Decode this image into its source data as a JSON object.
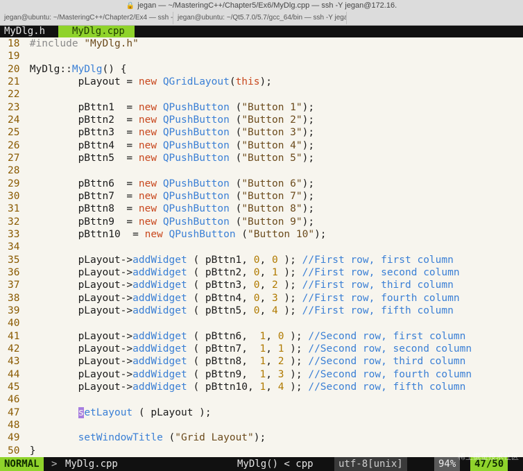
{
  "window": {
    "title": "jegan — ~/MasteringC++/Chapter5/Ex6/MyDlg.cpp — ssh -Y jegan@172.16.",
    "tabs": [
      "jegan@ubuntu: ~/MasteringC++/Chapter2/Ex4 — ssh -Y...",
      "jegan@ubuntu: ~/Qt5.7.0/5.7/gcc_64/bin — ssh -Y jegan...",
      ""
    ]
  },
  "tabline": {
    "buffers": [
      "MyDlg.h",
      "MyDlg.cpp"
    ],
    "active_index": 1
  },
  "code": {
    "lines": [
      {
        "n": "18",
        "tokens": [
          [
            "#include ",
            "pre"
          ],
          [
            "\"MyDlg.h\"",
            "str"
          ]
        ]
      },
      {
        "n": "19",
        "tokens": []
      },
      {
        "n": "20",
        "tokens": [
          [
            "MyDlg::",
            "plain"
          ],
          [
            "MyDlg",
            "type"
          ],
          [
            "() {",
            "plain"
          ]
        ]
      },
      {
        "n": "21",
        "tokens": [
          [
            "        pLayout = ",
            "plain"
          ],
          [
            "new",
            "kw"
          ],
          [
            " ",
            "plain"
          ],
          [
            "QGridLayout",
            "type"
          ],
          [
            "(",
            "plain"
          ],
          [
            "this",
            "kw"
          ],
          [
            ");",
            "plain"
          ]
        ]
      },
      {
        "n": "22",
        "tokens": []
      },
      {
        "n": "23",
        "tokens": [
          [
            "        pBttn1  = ",
            "plain"
          ],
          [
            "new",
            "kw"
          ],
          [
            " ",
            "plain"
          ],
          [
            "QPushButton",
            "type"
          ],
          [
            " (",
            "plain"
          ],
          [
            "\"Button 1\"",
            "str"
          ],
          [
            ");",
            "plain"
          ]
        ]
      },
      {
        "n": "24",
        "tokens": [
          [
            "        pBttn2  = ",
            "plain"
          ],
          [
            "new",
            "kw"
          ],
          [
            " ",
            "plain"
          ],
          [
            "QPushButton",
            "type"
          ],
          [
            " (",
            "plain"
          ],
          [
            "\"Button 2\"",
            "str"
          ],
          [
            ");",
            "plain"
          ]
        ]
      },
      {
        "n": "25",
        "tokens": [
          [
            "        pBttn3  = ",
            "plain"
          ],
          [
            "new",
            "kw"
          ],
          [
            " ",
            "plain"
          ],
          [
            "QPushButton",
            "type"
          ],
          [
            " (",
            "plain"
          ],
          [
            "\"Button 3\"",
            "str"
          ],
          [
            ");",
            "plain"
          ]
        ]
      },
      {
        "n": "26",
        "tokens": [
          [
            "        pBttn4  = ",
            "plain"
          ],
          [
            "new",
            "kw"
          ],
          [
            " ",
            "plain"
          ],
          [
            "QPushButton",
            "type"
          ],
          [
            " (",
            "plain"
          ],
          [
            "\"Button 4\"",
            "str"
          ],
          [
            ");",
            "plain"
          ]
        ]
      },
      {
        "n": "27",
        "tokens": [
          [
            "        pBttn5  = ",
            "plain"
          ],
          [
            "new",
            "kw"
          ],
          [
            " ",
            "plain"
          ],
          [
            "QPushButton",
            "type"
          ],
          [
            " (",
            "plain"
          ],
          [
            "\"Button 5\"",
            "str"
          ],
          [
            ");",
            "plain"
          ]
        ]
      },
      {
        "n": "28",
        "tokens": []
      },
      {
        "n": "29",
        "tokens": [
          [
            "        pBttn6  = ",
            "plain"
          ],
          [
            "new",
            "kw"
          ],
          [
            " ",
            "plain"
          ],
          [
            "QPushButton",
            "type"
          ],
          [
            " (",
            "plain"
          ],
          [
            "\"Button 6\"",
            "str"
          ],
          [
            ");",
            "plain"
          ]
        ]
      },
      {
        "n": "30",
        "tokens": [
          [
            "        pBttn7  = ",
            "plain"
          ],
          [
            "new",
            "kw"
          ],
          [
            " ",
            "plain"
          ],
          [
            "QPushButton",
            "type"
          ],
          [
            " (",
            "plain"
          ],
          [
            "\"Button 7\"",
            "str"
          ],
          [
            ");",
            "plain"
          ]
        ]
      },
      {
        "n": "31",
        "tokens": [
          [
            "        pBttn8  = ",
            "plain"
          ],
          [
            "new",
            "kw"
          ],
          [
            " ",
            "plain"
          ],
          [
            "QPushButton",
            "type"
          ],
          [
            " (",
            "plain"
          ],
          [
            "\"Button 8\"",
            "str"
          ],
          [
            ");",
            "plain"
          ]
        ]
      },
      {
        "n": "32",
        "tokens": [
          [
            "        pBttn9  = ",
            "plain"
          ],
          [
            "new",
            "kw"
          ],
          [
            " ",
            "plain"
          ],
          [
            "QPushButton",
            "type"
          ],
          [
            " (",
            "plain"
          ],
          [
            "\"Button 9\"",
            "str"
          ],
          [
            ");",
            "plain"
          ]
        ]
      },
      {
        "n": "33",
        "tokens": [
          [
            "        pBttn10  = ",
            "plain"
          ],
          [
            "new",
            "kw"
          ],
          [
            " ",
            "plain"
          ],
          [
            "QPushButton",
            "type"
          ],
          [
            " (",
            "plain"
          ],
          [
            "\"Button 10\"",
            "str"
          ],
          [
            ");",
            "plain"
          ]
        ]
      },
      {
        "n": "34",
        "tokens": []
      },
      {
        "n": "35",
        "tokens": [
          [
            "        pLayout->",
            "plain"
          ],
          [
            "addWidget",
            "type"
          ],
          [
            " ( pBttn1, ",
            "plain"
          ],
          [
            "0",
            "num"
          ],
          [
            ", ",
            "plain"
          ],
          [
            "0",
            "num"
          ],
          [
            " ); ",
            "plain"
          ],
          [
            "//First row, first column",
            "comment"
          ]
        ]
      },
      {
        "n": "36",
        "tokens": [
          [
            "        pLayout->",
            "plain"
          ],
          [
            "addWidget",
            "type"
          ],
          [
            " ( pBttn2, ",
            "plain"
          ],
          [
            "0",
            "num"
          ],
          [
            ", ",
            "plain"
          ],
          [
            "1",
            "num"
          ],
          [
            " ); ",
            "plain"
          ],
          [
            "//First row, second column",
            "comment"
          ]
        ]
      },
      {
        "n": "37",
        "tokens": [
          [
            "        pLayout->",
            "plain"
          ],
          [
            "addWidget",
            "type"
          ],
          [
            " ( pBttn3, ",
            "plain"
          ],
          [
            "0",
            "num"
          ],
          [
            ", ",
            "plain"
          ],
          [
            "2",
            "num"
          ],
          [
            " ); ",
            "plain"
          ],
          [
            "//First row, third column",
            "comment"
          ]
        ]
      },
      {
        "n": "38",
        "tokens": [
          [
            "        pLayout->",
            "plain"
          ],
          [
            "addWidget",
            "type"
          ],
          [
            " ( pBttn4, ",
            "plain"
          ],
          [
            "0",
            "num"
          ],
          [
            ", ",
            "plain"
          ],
          [
            "3",
            "num"
          ],
          [
            " ); ",
            "plain"
          ],
          [
            "//First row, fourth column",
            "comment"
          ]
        ]
      },
      {
        "n": "39",
        "tokens": [
          [
            "        pLayout->",
            "plain"
          ],
          [
            "addWidget",
            "type"
          ],
          [
            " ( pBttn5, ",
            "plain"
          ],
          [
            "0",
            "num"
          ],
          [
            ", ",
            "plain"
          ],
          [
            "4",
            "num"
          ],
          [
            " ); ",
            "plain"
          ],
          [
            "//First row, fifth column",
            "comment"
          ]
        ]
      },
      {
        "n": "40",
        "tokens": []
      },
      {
        "n": "41",
        "tokens": [
          [
            "        pLayout->",
            "plain"
          ],
          [
            "addWidget",
            "type"
          ],
          [
            " ( pBttn6,  ",
            "plain"
          ],
          [
            "1",
            "num"
          ],
          [
            ", ",
            "plain"
          ],
          [
            "0",
            "num"
          ],
          [
            " ); ",
            "plain"
          ],
          [
            "//Second row, first column",
            "comment"
          ]
        ]
      },
      {
        "n": "42",
        "tokens": [
          [
            "        pLayout->",
            "plain"
          ],
          [
            "addWidget",
            "type"
          ],
          [
            " ( pBttn7,  ",
            "plain"
          ],
          [
            "1",
            "num"
          ],
          [
            ", ",
            "plain"
          ],
          [
            "1",
            "num"
          ],
          [
            " ); ",
            "plain"
          ],
          [
            "//Second row, second column",
            "comment"
          ]
        ]
      },
      {
        "n": "43",
        "tokens": [
          [
            "        pLayout->",
            "plain"
          ],
          [
            "addWidget",
            "type"
          ],
          [
            " ( pBttn8,  ",
            "plain"
          ],
          [
            "1",
            "num"
          ],
          [
            ", ",
            "plain"
          ],
          [
            "2",
            "num"
          ],
          [
            " ); ",
            "plain"
          ],
          [
            "//Second row, third column",
            "comment"
          ]
        ]
      },
      {
        "n": "44",
        "tokens": [
          [
            "        pLayout->",
            "plain"
          ],
          [
            "addWidget",
            "type"
          ],
          [
            " ( pBttn9,  ",
            "plain"
          ],
          [
            "1",
            "num"
          ],
          [
            ", ",
            "plain"
          ],
          [
            "3",
            "num"
          ],
          [
            " ); ",
            "plain"
          ],
          [
            "//Second row, fourth column",
            "comment"
          ]
        ]
      },
      {
        "n": "45",
        "tokens": [
          [
            "        pLayout->",
            "plain"
          ],
          [
            "addWidget",
            "type"
          ],
          [
            " ( pBttn10, ",
            "plain"
          ],
          [
            "1",
            "num"
          ],
          [
            ", ",
            "plain"
          ],
          [
            "4",
            "num"
          ],
          [
            " ); ",
            "plain"
          ],
          [
            "//Second row, fifth column",
            "comment"
          ]
        ]
      },
      {
        "n": "46",
        "tokens": []
      },
      {
        "n": "47",
        "tokens": [
          [
            "        ",
            "plain"
          ],
          [
            "s",
            "cursor"
          ],
          [
            "etLayout",
            "type"
          ],
          [
            " ( pLayout );",
            "plain"
          ]
        ]
      },
      {
        "n": "48",
        "tokens": []
      },
      {
        "n": "49",
        "tokens": [
          [
            "        ",
            "plain"
          ],
          [
            "setWindowTitle",
            "type"
          ],
          [
            " (",
            "plain"
          ],
          [
            "\"Grid Layout\"",
            "str"
          ],
          [
            ");",
            "plain"
          ]
        ]
      },
      {
        "n": "50",
        "tokens": [
          [
            "}",
            "plain"
          ]
        ]
      }
    ]
  },
  "statusline": {
    "mode": "NORMAL",
    "separator": ">",
    "file": "MyDlg.cpp",
    "function": "MyDlg() < cpp",
    "encoding": "utf-8[unix]",
    "percent": "94%",
    "position": "47/50"
  },
  "watermark": "稀土掘金技术社区"
}
